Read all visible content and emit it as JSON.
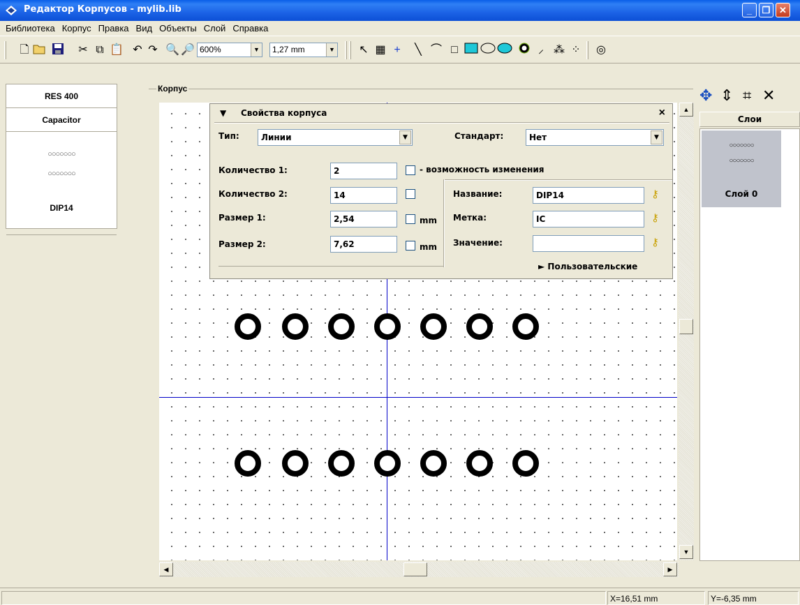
{
  "window": {
    "title": "Редактор Корпусов - mylib.lib",
    "min_glyph": "_",
    "restore_glyph": "❐",
    "close_glyph": "✕"
  },
  "menu": [
    "Библиотека",
    "Корпус",
    "Правка",
    "Вид",
    "Объекты",
    "Слой",
    "Справка"
  ],
  "toolbar": {
    "zoom": "600%",
    "grid": "1,27 mm",
    "icons": [
      "new-icon",
      "open-icon",
      "save-icon",
      "cut-icon",
      "copy-icon",
      "paste-icon",
      "undo-icon",
      "redo-icon",
      "zoom-in-icon",
      "zoom-fit-icon",
      "select-arrow-icon",
      "pad-icon",
      "origin-cross-icon",
      "line-icon",
      "arc-icon",
      "rect-icon",
      "filled-rect-icon",
      "ellipse-icon",
      "filled-ellipse-icon",
      "pad-circle-icon",
      "wire-icon",
      "array-icon",
      "pattern-icon",
      "target-icon"
    ]
  },
  "library": {
    "items": [
      "RES 400",
      "Capacitor",
      "DIP14"
    ]
  },
  "group_label": "Корпус",
  "props": {
    "header": "Свойства корпуса",
    "close": "×",
    "type_label": "Тип:",
    "type_value": "Линии",
    "standard_label": "Стандарт:",
    "standard_value": "Нет",
    "qty1_label": "Количество 1:",
    "qty1_value": "2",
    "qty2_label": "Количество 2:",
    "qty2_value": "14",
    "size1_label": "Размер 1:",
    "size1_value": "2,54",
    "size2_label": "Размер 2:",
    "size2_value": "7,62",
    "changeable_label": "- возможность изменения",
    "mm1": "mm",
    "mm2": "mm",
    "name_label": "Название:",
    "name_value": "DIP14",
    "mark_label": "Метка:",
    "mark_value": "IC",
    "value_label": "Значение:",
    "value_value": "",
    "custom": "► Пользовательские"
  },
  "layers": {
    "header": "Слои",
    "layer0": "Слой 0"
  },
  "status": {
    "x": "X=16,51 mm",
    "y": "Y=-6,35 mm"
  }
}
